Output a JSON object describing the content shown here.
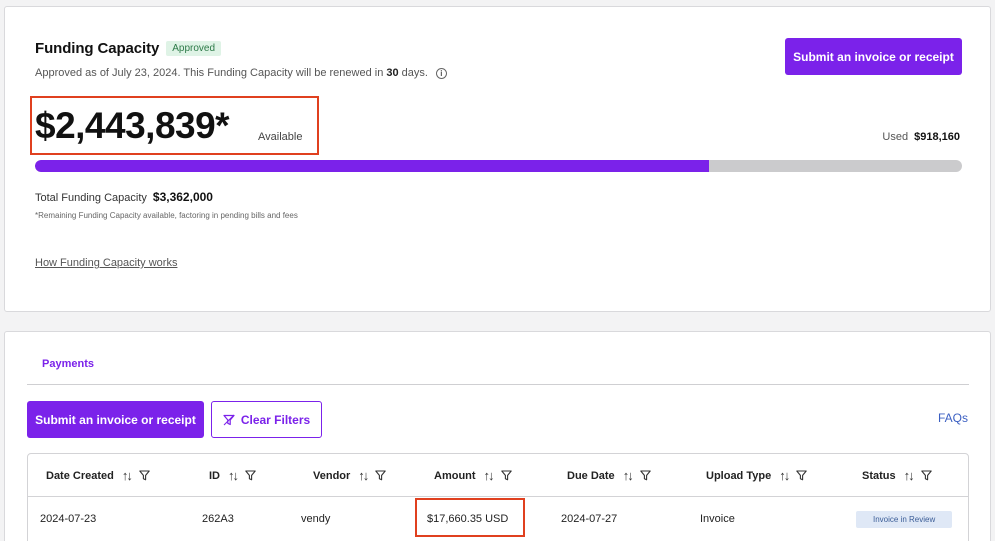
{
  "funding": {
    "title": "Funding Capacity",
    "badge": "Approved",
    "approved_prefix": "Approved as of July 23, 2024. This Funding Capacity will be renewed in",
    "renew_days": "30",
    "approved_suffix": "days.",
    "submit_label": "Submit an invoice or receipt",
    "available_amount": "$2,443,839*",
    "available_label": "Available",
    "used_label": "Used",
    "used_value": "$918,160",
    "used_fraction": 0.7269,
    "total_label": "Total Funding Capacity",
    "total_value": "$3,362,000",
    "footnote": "*Remaining Funding Capacity available, factoring in pending bills and fees",
    "how_link": "How Funding Capacity works"
  },
  "payments": {
    "tab_label": "Payments",
    "submit_label": "Submit an invoice or receipt",
    "clear_filters_label": "Clear Filters",
    "faqs_label": "FAQs",
    "columns": [
      "Date Created",
      "ID",
      "Vendor",
      "Amount",
      "Due Date",
      "Upload Type",
      "Status"
    ],
    "rows": [
      {
        "date_created": "2024-07-23",
        "id": "262A3",
        "vendor": "vendy",
        "amount": "$17,660.35 USD",
        "due_date": "2024-07-27",
        "upload_type": "Invoice",
        "status": "Invoice in Review"
      }
    ]
  },
  "colors": {
    "accent": "#7b22ea",
    "highlight_box": "#e0401f",
    "badge_bg": "#dff3e6",
    "status_bg": "#dfe8f6"
  }
}
